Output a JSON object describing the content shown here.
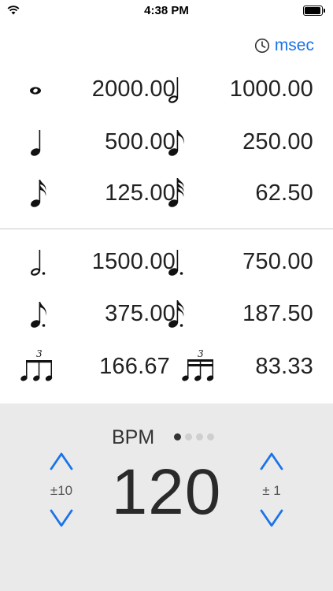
{
  "status_bar": {
    "time": "4:38 PM",
    "wifi_icon": "wifi-icon",
    "battery_icon": "battery-icon",
    "battery_level": 0.95
  },
  "unit_toggle": {
    "icon": "clock-icon",
    "label": "msec",
    "color": "#1a73e8"
  },
  "notes_top": [
    {
      "note": "whole-note",
      "value": "2000.00"
    },
    {
      "note": "half-note",
      "value": "1000.00"
    },
    {
      "note": "quarter-note",
      "value": "500.00"
    },
    {
      "note": "eighth-note",
      "value": "250.00"
    },
    {
      "note": "sixteenth-note",
      "value": "125.00"
    },
    {
      "note": "thirty-second-note",
      "value": "62.50"
    }
  ],
  "notes_bottom": [
    {
      "note": "dotted-half-note",
      "value": "1500.00"
    },
    {
      "note": "dotted-quarter-note",
      "value": "750.00"
    },
    {
      "note": "dotted-eighth-note",
      "value": "375.00"
    },
    {
      "note": "dotted-sixteenth-note",
      "value": "187.50"
    },
    {
      "note": "eighth-triplet",
      "value": "166.67",
      "tuplet": "3"
    },
    {
      "note": "sixteenth-triplet",
      "value": "83.33",
      "tuplet": "3"
    }
  ],
  "tempo": {
    "label": "BPM",
    "value": "120",
    "coarse_step_label": "±10",
    "fine_step_label": "± 1",
    "page_count": 4,
    "active_page": 1,
    "arrow_color": "#1a73e8",
    "panel_color": "#eaeaea"
  }
}
